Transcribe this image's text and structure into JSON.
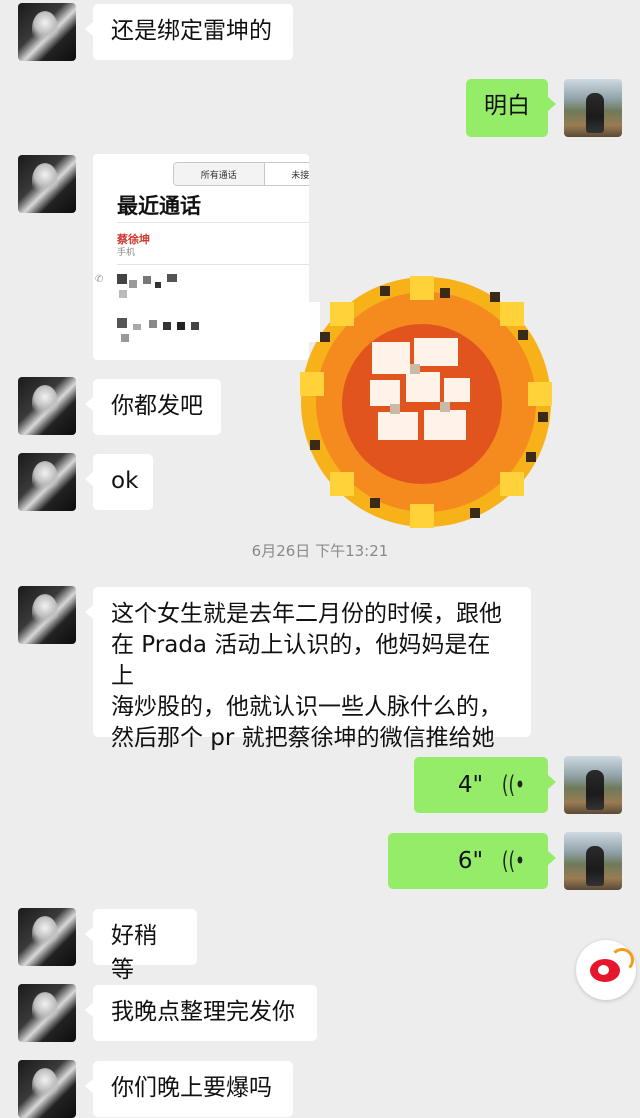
{
  "messages": [
    {
      "side": "left",
      "text": "还是绑定雷坤的"
    },
    {
      "side": "right",
      "text": "明白"
    },
    {
      "side": "left",
      "type": "image",
      "call_log": {
        "tabs": [
          "所有通话",
          "未接来电"
        ],
        "title": "最近通话",
        "caller_name": "蔡徐坤",
        "caller_type": "手机"
      }
    },
    {
      "side": "left",
      "type": "sticker"
    },
    {
      "side": "left",
      "text": "你都发吧"
    },
    {
      "side": "left",
      "text": "ok"
    },
    {
      "side": "left",
      "lines": [
        "这个女生就是去年二月份的时候，跟他",
        "在 Prada 活动上认识的，他妈妈是在上",
        "海炒股的，他就认识一些人脉什么的，",
        "然后那个 pr 就把蔡徐坤的微信推给她"
      ]
    },
    {
      "side": "right",
      "type": "voice",
      "duration": "4\""
    },
    {
      "side": "right",
      "type": "voice",
      "duration": "6\""
    },
    {
      "side": "left",
      "text": "好稍等"
    },
    {
      "side": "left",
      "text": "我晚点整理完发你"
    },
    {
      "side": "left",
      "text": "你们晚上要爆吗"
    }
  ],
  "timestamp": "6月26日 下午13:21",
  "icons": {
    "voice": "voice-wave-icon",
    "watermark": "weibo-logo-icon"
  },
  "colors": {
    "background": "#ededed",
    "incoming_bubble": "#ffffff",
    "outgoing_bubble": "#95ec69",
    "weibo_red": "#e6162d"
  }
}
